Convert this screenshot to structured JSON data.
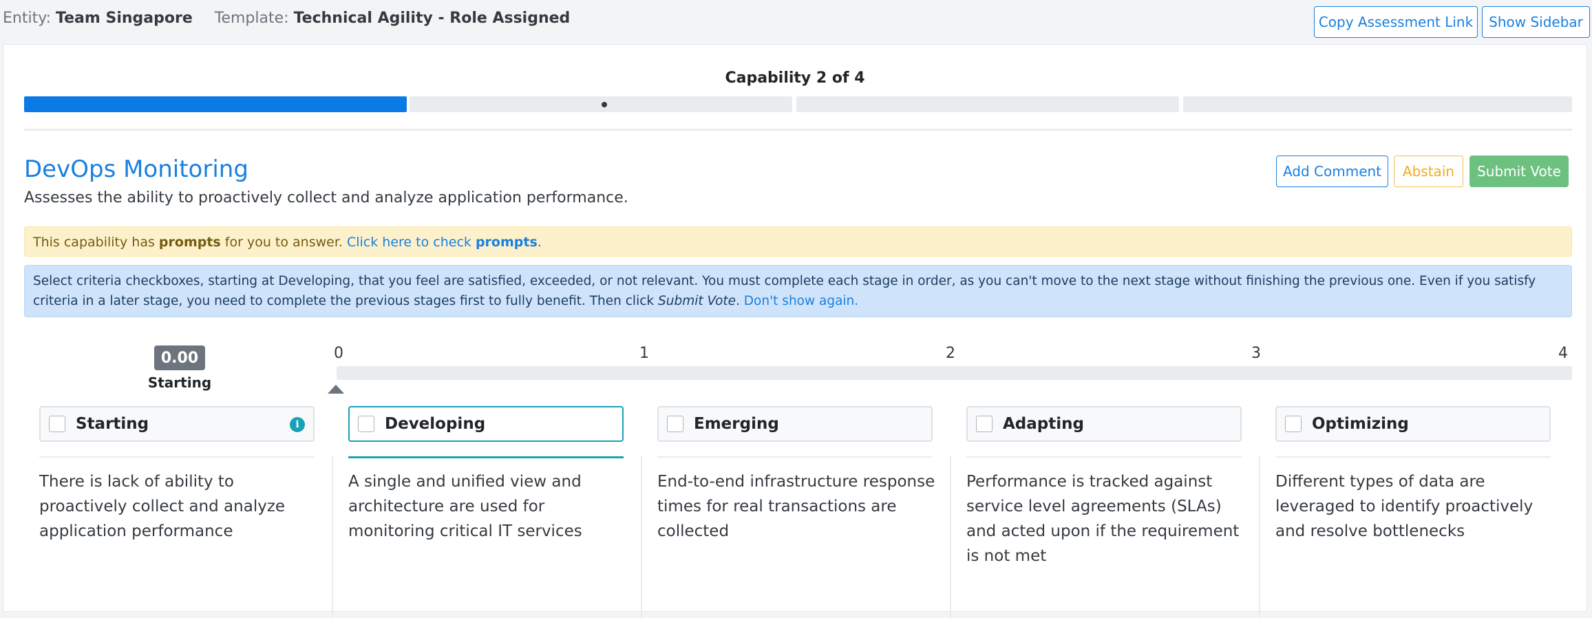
{
  "header": {
    "entity_label": "Entity:",
    "entity_value": "Team Singapore",
    "template_label": "Template:",
    "template_value": "Technical Agility - Role Assigned",
    "copy_link_label": "Copy Assessment Link",
    "show_sidebar_label": "Show Sidebar"
  },
  "progress": {
    "title": "Capability 2 of 4",
    "current": 2,
    "total": 4
  },
  "capability": {
    "name": "DevOps Monitoring",
    "description": "Assesses the ability to proactively collect and analyze application performance."
  },
  "actions": {
    "add_comment": "Add Comment",
    "abstain": "Abstain",
    "submit_vote": "Submit Vote"
  },
  "prompt_alert": {
    "text_before": "This capability has ",
    "prompts_word": "prompts",
    "text_middle": " for you to answer. ",
    "link_text": "Click here to check ",
    "link_bold": "prompts",
    "text_after": "."
  },
  "info_alert": {
    "text": "Select criteria checkboxes, starting at Developing, that you feel are satisfied, exceeded, or not relevant. You must complete each stage in order, as you can't move to the next stage without finishing the previous one. Even if you satisfy criteria in a later stage, you need to complete the previous stages first to fully benefit. Then click ",
    "italic": "Submit Vote",
    "after": ". ",
    "link": "Don't show again."
  },
  "score": {
    "value": "0.00",
    "label": "Starting"
  },
  "scale": {
    "ticks": [
      "0",
      "1",
      "2",
      "3",
      "4"
    ],
    "current_value": 0
  },
  "stages": [
    {
      "name": "Starting",
      "text": "There is lack of ability to proactively collect and analyze application performance",
      "active": false,
      "info_icon": true
    },
    {
      "name": "Developing",
      "text": "A single and unified view and architecture are used for monitoring critical IT services",
      "active": true,
      "info_icon": false
    },
    {
      "name": "Emerging",
      "text": "End-to-end infrastructure response times for real transactions are collected",
      "active": false,
      "info_icon": false
    },
    {
      "name": "Adapting",
      "text": "Performance is tracked against service level agreements (SLAs) and acted upon if the requirement is not met",
      "active": false,
      "info_icon": false
    },
    {
      "name": "Optimizing",
      "text": "Different types of data are leveraged to identify proactively and resolve bottlenecks",
      "active": false,
      "info_icon": false
    }
  ],
  "colors": {
    "primary": "#1a7fe0",
    "progress_fill": "#0a7ae6",
    "warning": "#f0ad1e",
    "success": "#6cc17e",
    "active_stage": "#17a2b8"
  }
}
